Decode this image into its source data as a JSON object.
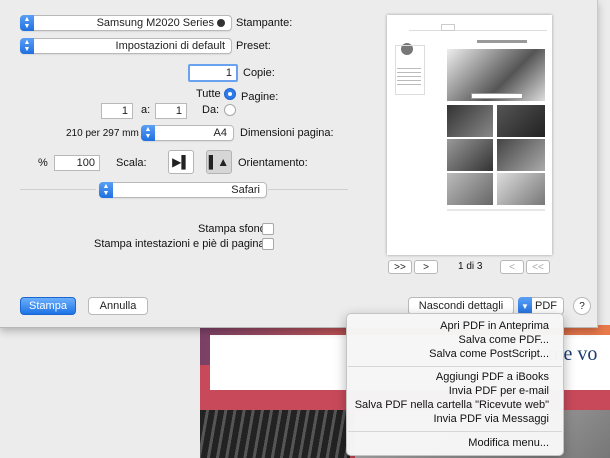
{
  "dialog": {
    "printer_label": "Stampante:",
    "printer_value": "Samsung M2020 Series",
    "preset_label": "Preset:",
    "preset_value": "Impostazioni di default",
    "copies_label": "Copie:",
    "copies_value": "1",
    "pages_label": "Pagine:",
    "pages_all": "Tutte",
    "pages_from": "Da:",
    "pages_from_value": "1",
    "pages_to": "a:",
    "pages_to_value": "1",
    "paper_label": "Dimensioni pagina:",
    "paper_value": "A4",
    "paper_size_text": "210 per 297 mm",
    "orientation_label": "Orientamento:",
    "scale_label": "Scala:",
    "scale_value": "100",
    "scale_unit": "%",
    "app_section": "Safari",
    "print_backgrounds": "Stampa sfondi",
    "print_headers": "Stampa intestazioni e piè di pagina"
  },
  "preview": {
    "page_counter": "1 di 3",
    "nav_first": "<<",
    "nav_prev": "<",
    "nav_next": ">",
    "nav_last": ">>"
  },
  "footer": {
    "help": "?",
    "pdf_label": "PDF",
    "hide_details": "Nascondi dettagli",
    "cancel": "Annulla",
    "print": "Stampa"
  },
  "pdf_menu": {
    "items": [
      "Apri PDF in Anteprima",
      "Salva come PDF...",
      "Salva come PostScript...",
      "Aggiungi PDF a iBooks",
      "Invia PDF per e-mail",
      "Salva PDF nella cartella \"Ricevute web\"",
      "Invia PDF via Messaggi",
      "Modifica menu..."
    ]
  },
  "background": {
    "title_fragment": "me vo"
  },
  "colors": {
    "accent": "#2d7bea",
    "dialog_bg": "#ececec"
  }
}
